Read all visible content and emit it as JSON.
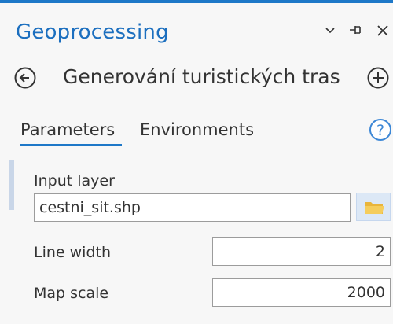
{
  "header": {
    "title": "Geoprocessing",
    "controls": {
      "options_icon": "chevron-down-icon",
      "pin_icon": "pin-icon",
      "close_icon": "close-icon"
    }
  },
  "tool": {
    "name": "Generování turistických tras",
    "back_icon": "circle-arrow-left-icon",
    "add_icon": "circle-plus-icon"
  },
  "tabs": [
    {
      "label": "Parameters",
      "active": true
    },
    {
      "label": "Environments",
      "active": false
    }
  ],
  "help_icon": "help-circle-icon",
  "params": {
    "input_layer": {
      "label": "Input layer",
      "value": "cestni_sit.shp",
      "browse_icon": "folder-icon"
    },
    "line_width": {
      "label": "Line width",
      "value": "2"
    },
    "map_scale": {
      "label": "Map scale",
      "value": "2000"
    }
  },
  "colors": {
    "accent": "#1e78c8",
    "panel_bg": "#f7f7f7",
    "folder": "#f2c24e"
  }
}
